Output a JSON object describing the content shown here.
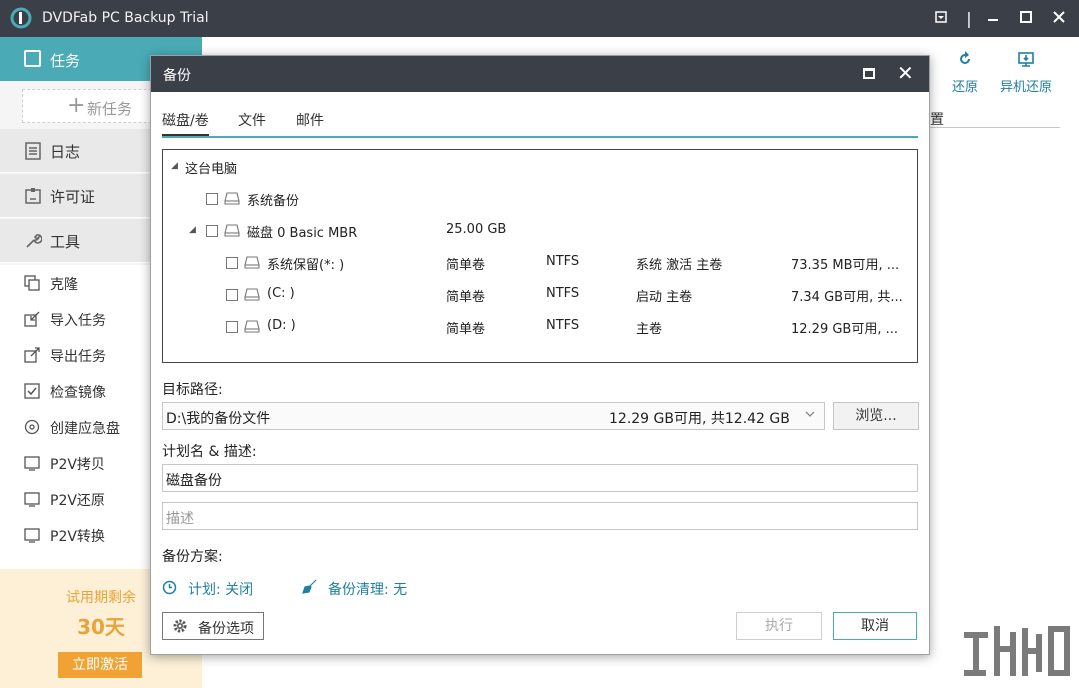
{
  "app": {
    "title": "DVDFab PC Backup Trial"
  },
  "sidebar": {
    "task_label": "任务",
    "new_task_label": "新任务",
    "blocks": [
      "日志",
      "许可证",
      "工具"
    ],
    "items": [
      "克隆",
      "导入任务",
      "导出任务",
      "检查镜像",
      "创建应急盘",
      "P2V拷贝",
      "P2V还原",
      "P2V转换"
    ],
    "trial_label": "试用期剩余",
    "trial_days": "30天",
    "activate_label": "立即激活"
  },
  "main": {
    "restore_label": "还原",
    "remote_restore_label": "异机还原",
    "col_label": "置"
  },
  "dialog": {
    "title": "备份",
    "tabs": [
      "磁盘/卷",
      "文件",
      "邮件"
    ],
    "tree": {
      "root": "这台电脑",
      "system_backup": "系统备份",
      "disk": {
        "name": "磁盘 0 Basic MBR",
        "size": "25.00 GB"
      },
      "partitions": [
        {
          "name": "系统保留(*: )",
          "type": "简单卷",
          "fs": "NTFS",
          "status": "系统 激活 主卷",
          "free": "73.35 MB可用, ..."
        },
        {
          "name": "(C: )",
          "type": "简单卷",
          "fs": "NTFS",
          "status": "启动 主卷",
          "free": "7.34 GB可用, 共..."
        },
        {
          "name": "(D: )",
          "type": "简单卷",
          "fs": "NTFS",
          "status": "主卷",
          "free": "12.29 GB可用, ..."
        }
      ]
    },
    "target_label": "目标路径:",
    "target_path": "D:\\我的备份文件",
    "target_free": "12.29 GB可用, 共12.42 GB",
    "browse_label": "浏览...",
    "plan_label": "计划名 & 描述:",
    "plan_name": "磁盘备份",
    "desc_placeholder": "描述",
    "scheme_label": "备份方案:",
    "schedule_text": "计划: 关闭",
    "cleanup_text": "备份清理: 无",
    "options_label": "备份选项",
    "execute_label": "执行",
    "cancel_label": "取消"
  },
  "colors": {
    "accent": "#4aabb6",
    "titlebar": "#3a3f48",
    "link": "#1f7fa0",
    "trial": "#f0a234"
  }
}
